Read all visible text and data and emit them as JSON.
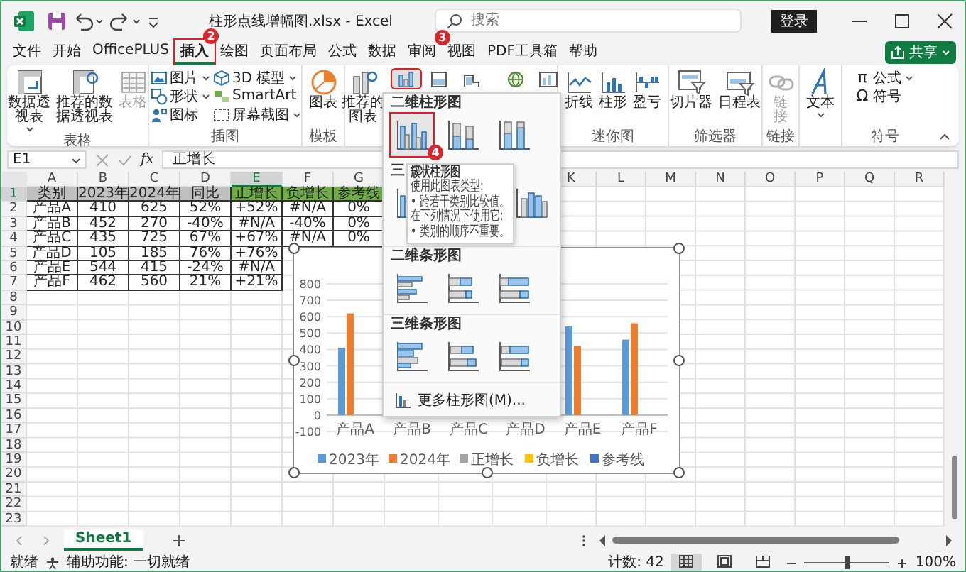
{
  "window": {
    "title": "柱形点线增幅图.xlsx - Excel",
    "search_placeholder": "搜索",
    "sign_in": "登录"
  },
  "menu_tabs": [
    {
      "label": "文件",
      "selected": false
    },
    {
      "label": "开始",
      "selected": false
    },
    {
      "label": "OfficePLUS",
      "selected": false
    },
    {
      "label": "插入",
      "selected": true
    },
    {
      "label": "绘图",
      "selected": false
    },
    {
      "label": "页面布局",
      "selected": false
    },
    {
      "label": "公式",
      "selected": false
    },
    {
      "label": "数据",
      "selected": false
    },
    {
      "label": "审阅",
      "selected": false
    },
    {
      "label": "视图",
      "selected": false
    },
    {
      "label": "PDF工具箱",
      "selected": false
    },
    {
      "label": "帮助",
      "selected": false
    }
  ],
  "share_button": "共享",
  "ribbon": {
    "groups": [
      {
        "label": "表格",
        "buttons": [
          {
            "label": "数据透视表",
            "disabled": false,
            "dropdown": true
          },
          {
            "label": "推荐的数据透视表",
            "disabled": false,
            "dropdown": false
          },
          {
            "label": "表格",
            "disabled": true,
            "dropdown": false
          }
        ]
      },
      {
        "label": "插图",
        "buttons": [
          {
            "label": "图片",
            "disabled": false,
            "dropdown": true
          },
          {
            "label": "形状",
            "disabled": false,
            "dropdown": true
          },
          {
            "label": "图标",
            "disabled": false,
            "dropdown": false
          },
          {
            "label": "3D 模型",
            "disabled": false,
            "dropdown": true
          },
          {
            "label": "SmartArt",
            "disabled": false,
            "dropdown": false
          },
          {
            "label": "屏幕截图",
            "disabled": false,
            "dropdown": true
          }
        ]
      },
      {
        "label": "模板",
        "buttons": [
          {
            "label": "图表",
            "disabled": false,
            "dropdown": false
          }
        ]
      },
      {
        "buttons": [
          {
            "label": "推荐的图表",
            "disabled": false,
            "dropdown": false
          }
        ]
      },
      {
        "label": "迷你图",
        "buttons": [
          {
            "label": "折线",
            "disabled": false,
            "dropdown": false
          },
          {
            "label": "柱形",
            "disabled": false,
            "dropdown": false
          },
          {
            "label": "盈亏",
            "disabled": false,
            "dropdown": false
          }
        ]
      },
      {
        "label": "筛选器",
        "buttons": [
          {
            "label": "切片器",
            "disabled": false,
            "dropdown": false
          },
          {
            "label": "日程表",
            "disabled": false,
            "dropdown": false
          }
        ]
      },
      {
        "label": "链接",
        "buttons": [
          {
            "label": "链接",
            "disabled": true,
            "dropdown": false
          }
        ]
      },
      {
        "buttons": [
          {
            "label": "文本",
            "disabled": false,
            "dropdown": true
          }
        ]
      },
      {
        "label": "符号",
        "buttons": [
          {
            "label": "公式",
            "glyph": "π",
            "disabled": false,
            "dropdown": true
          },
          {
            "label": "符号",
            "glyph": "Ω",
            "disabled": false,
            "dropdown": false
          }
        ]
      }
    ],
    "chart_buttons": [
      {
        "selected": true
      },
      {
        "selected": false
      },
      {
        "selected": false
      },
      {
        "selected": false
      },
      {
        "selected": false
      }
    ]
  },
  "formula_bar": {
    "name_box": "E1",
    "function_label": "fx",
    "value": "正增长"
  },
  "sheet": {
    "columns": [
      {
        "label": "A",
        "selected": false
      },
      {
        "label": "B",
        "selected": false
      },
      {
        "label": "C",
        "selected": false
      },
      {
        "label": "D",
        "selected": false
      },
      {
        "label": "E",
        "selected": true
      },
      {
        "label": "F",
        "selected": false
      },
      {
        "label": "G",
        "selected": false
      }
    ],
    "more_columns": [
      {
        "label": "K",
        "selected": false
      },
      {
        "label": "L",
        "selected": false
      },
      {
        "label": "M",
        "selected": false
      },
      {
        "label": "N",
        "selected": false
      },
      {
        "label": "O",
        "selected": false
      },
      {
        "label": "P",
        "selected": false
      },
      {
        "label": "Q",
        "selected": false
      },
      {
        "label": "R",
        "selected": false
      }
    ],
    "row_numbers": [
      {
        "label": "1",
        "selected": true
      },
      {
        "label": "2",
        "selected": false
      },
      {
        "label": "3",
        "selected": false
      },
      {
        "label": "4",
        "selected": false
      },
      {
        "label": "5",
        "selected": false
      },
      {
        "label": "6",
        "selected": false
      },
      {
        "label": "7",
        "selected": false
      },
      {
        "label": "8",
        "selected": false
      },
      {
        "label": "9",
        "selected": false
      },
      {
        "label": "10",
        "selected": false
      },
      {
        "label": "11",
        "selected": false
      },
      {
        "label": "12",
        "selected": false
      },
      {
        "label": "13",
        "selected": false
      },
      {
        "label": "14",
        "selected": false
      },
      {
        "label": "15",
        "selected": false
      },
      {
        "label": "16",
        "selected": false
      },
      {
        "label": "17",
        "selected": false
      },
      {
        "label": "18",
        "selected": false
      },
      {
        "label": "19",
        "selected": false
      },
      {
        "label": "20",
        "selected": false
      },
      {
        "label": "21",
        "selected": false
      },
      {
        "label": "22",
        "selected": false
      },
      {
        "label": "23",
        "selected": false
      }
    ],
    "header": [
      {
        "text": "类别",
        "color": "#bfbfbf"
      },
      {
        "text": "2023年",
        "color": "#bfbfbf"
      },
      {
        "text": "2024年",
        "color": "#bfbfbf"
      },
      {
        "text": "同比",
        "color": "#bfbfbf"
      },
      {
        "text": "正增长",
        "color": "#70ad47"
      },
      {
        "text": "负增长",
        "color": "#70ad47"
      },
      {
        "text": "参考线",
        "color": "#70ad47"
      }
    ],
    "rows": [
      [
        "产品A",
        "410",
        "625",
        "52%",
        "+52%",
        "#N/A",
        "0%"
      ],
      [
        "产品B",
        "452",
        "270",
        "-40%",
        "#N/A",
        "-40%",
        "0%"
      ],
      [
        "产品C",
        "435",
        "725",
        "67%",
        "+67%",
        "#N/A",
        "0%"
      ],
      [
        "产品D",
        "105",
        "185",
        "76%",
        "+76%"
      ],
      [
        "产品E",
        "544",
        "415",
        "-24%",
        "#N/A"
      ],
      [
        "产品F",
        "462",
        "560",
        "21%",
        "+21%"
      ]
    ]
  },
  "chart": {
    "chart_data": {
      "type": "bar",
      "grid": true,
      "legend": "bottom",
      "categories": [
        "产品A",
        "产品B",
        "产品C",
        "产品D",
        "产品E",
        "产品F"
      ],
      "series": [
        {
          "name": "2023年",
          "color": "#5b9bd5",
          "values": [
            410,
            null,
            null,
            null,
            540,
            460
          ]
        },
        {
          "name": "2024年",
          "color": "#ed7d31",
          "values": [
            620,
            null,
            null,
            null,
            420,
            560
          ]
        },
        {
          "name": "正增长",
          "color": "#a5a5a5",
          "values": [
            0,
            null,
            null,
            null,
            null,
            0
          ]
        },
        {
          "name": "负增长",
          "color": "#ffc000",
          "values": [
            null,
            null,
            null,
            null,
            0,
            null
          ]
        },
        {
          "name": "参考线",
          "color": "#4472c4",
          "values": [
            0,
            null,
            null,
            null,
            0,
            0
          ]
        }
      ],
      "ylim": [
        -100,
        800
      ],
      "yticks": [
        -100,
        0,
        100,
        200,
        300,
        400,
        500,
        600,
        700,
        800
      ]
    }
  },
  "chart_menu": {
    "sections": [
      {
        "title": "二维柱形图",
        "kind": "column2d",
        "options": [
          {
            "selected": true
          },
          {
            "selected": false
          },
          {
            "selected": false
          }
        ]
      },
      {
        "title": "三",
        "kind": "column3d",
        "options": [
          {
            "selected": false
          },
          {
            "selected": false
          }
        ]
      },
      {
        "title": "二维条形图",
        "kind": "bar2d",
        "options": [
          {
            "selected": false
          },
          {
            "selected": false
          },
          {
            "selected": false
          }
        ]
      },
      {
        "title": "三维条形图",
        "kind": "bar3d",
        "options": [
          {
            "selected": false
          },
          {
            "selected": false
          },
          {
            "selected": false
          }
        ]
      }
    ],
    "more": "更多柱形图(M)...",
    "tooltip": {
      "title": "簇状柱形图",
      "lines": [
        "使用此图表类型:",
        "• 跨若干类别比较值。",
        "在下列情况下使用它:",
        "• 类别的顺序不重要。"
      ]
    }
  },
  "annotations": [
    {
      "number": "2"
    },
    {
      "number": "3"
    },
    {
      "number": "4"
    }
  ],
  "sheet_tabs": [
    {
      "label": "Sheet1",
      "selected": true
    }
  ],
  "status_bar": {
    "ready": "就绪",
    "accessibility": "辅助功能: 一切就绪",
    "count": "计数: 42",
    "views": [
      {
        "selected": true
      },
      {
        "selected": false
      },
      {
        "selected": false
      }
    ],
    "zoom": {
      "level": 0.5,
      "reading": "100%"
    }
  }
}
